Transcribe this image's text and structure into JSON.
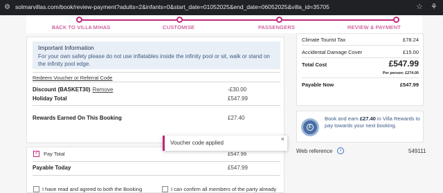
{
  "browser": {
    "url": "solmarvillas.com/book/review-payment?adults=2&infants=0&start_date=01052025&end_date=06052025&villa_id=35705"
  },
  "stepper": {
    "steps": [
      "BACK TO VILLA MIHAS",
      "CUSTOMISE",
      "PASSENGERS",
      "REVIEW & PAYMENT"
    ]
  },
  "info": {
    "title": "Important Information",
    "text": "For your own safety please do not use inflatables inside the infinity pool or sit, walk or stand on the infinity pool edge."
  },
  "voucher": {
    "redeem_label": "Redeem Voucher or Referral Code",
    "discount_label": "Discount (BASKET30)",
    "remove_label": "Remove",
    "discount_value": "-£30.00",
    "holiday_total_label": "Holiday Total",
    "holiday_total_value": "£547.99",
    "rewards_label": "Rewards Earned On This Booking",
    "rewards_value": "£27.40"
  },
  "payment": {
    "pay_total_label": "Pay Total",
    "pay_total_value": "£547.99",
    "payable_today_label": "Payable Today",
    "payable_today_value": "£547.99",
    "terms_text": "I have read and agreed to both the Booking",
    "party_text": "I can confirm all members of the party already"
  },
  "toast": {
    "message": "Voucher code applied",
    "close": "×"
  },
  "summary": {
    "climate_label": "Climate Tourist Tax",
    "climate_value": "£78.24",
    "damage_label": "Accidental Damage Cover",
    "damage_value": "£15.00",
    "total_label": "Total Cost",
    "total_value": "£547.99",
    "per_person": "Per person: £274.00",
    "payable_now_label": "Payable Now",
    "payable_now_value": "£547.99"
  },
  "rewards": {
    "text_prefix": "Book and earn ",
    "amount": "£27.40",
    "text_suffix": " in Villa Rewards to pay towards your next booking."
  },
  "webref": {
    "label": "Web reference",
    "value": "549111"
  },
  "colors": {
    "accent": "#c0267a",
    "info_bg": "#e9eff6",
    "info_text": "#3c5a86"
  }
}
